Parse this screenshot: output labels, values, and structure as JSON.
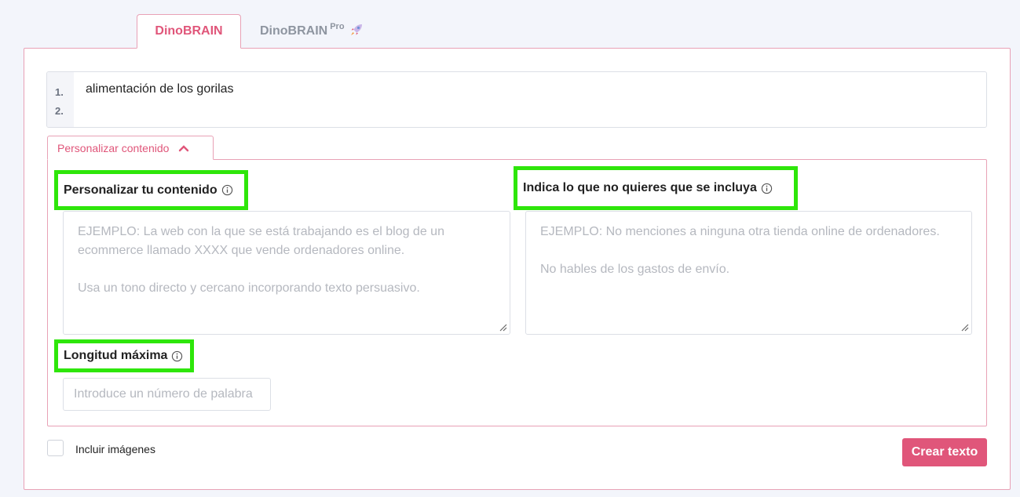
{
  "tabs": {
    "basic": "DinoBRAIN",
    "pro": "DinoBRAIN",
    "pro_badge": "Pro"
  },
  "editor": {
    "line_numbers": [
      "1.",
      "2."
    ],
    "content": "alimentación de los gorilas"
  },
  "customize": {
    "toggle_label": "Personalizar contenido",
    "content_label": "Personalizar tu contenido",
    "content_placeholder_1": "EJEMPLO: La web con la que se está trabajando es el blog de un ecommerce llamado XXXX que vende ordenadores online.",
    "content_placeholder_2": "Usa un tono directo y cercano incorporando texto persuasivo.",
    "exclude_label": "Indica lo que no quieres que se incluya",
    "exclude_placeholder_1": "EJEMPLO: No menciones a ninguna otra tienda online de ordenadores.",
    "exclude_placeholder_2": "No hables de los gastos de envío.",
    "length_label": "Longitud máxima",
    "length_placeholder": "Introduce un número de palabra"
  },
  "footer": {
    "include_images_label": "Incluir imágenes",
    "create_button": "Crear texto"
  },
  "colors": {
    "accent": "#e0567a",
    "highlight": "#2ee60a"
  }
}
